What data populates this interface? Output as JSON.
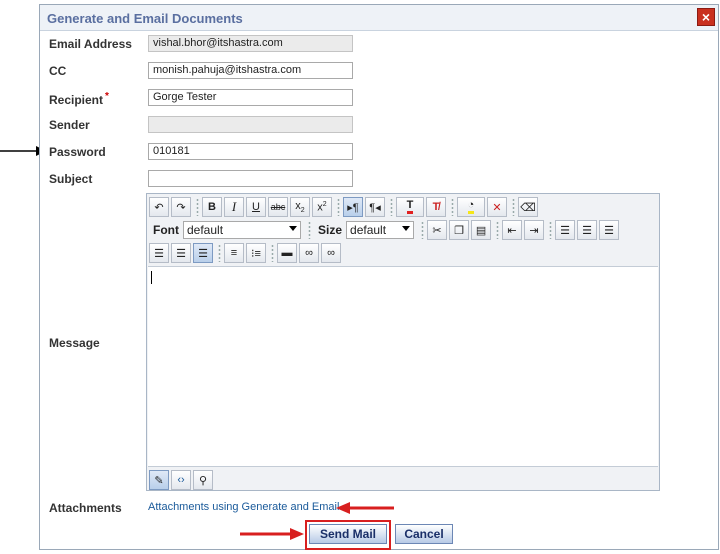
{
  "dialog": {
    "title": "Generate and Email Documents",
    "close_symbol": "×"
  },
  "form": {
    "email_address_label": "Email Address",
    "email_address_value": "vishal.bhor@itshastra.com",
    "cc_label": "CC",
    "cc_value": "monish.pahuja@itshastra.com",
    "recipient_label": "Recipient",
    "recipient_required": "*",
    "recipient_value": "Gorge Tester",
    "sender_label": "Sender",
    "sender_value": "",
    "password_label": "Password",
    "password_value": "010181",
    "subject_label": "Subject",
    "subject_value": "",
    "message_label": "Message",
    "attachments_label": "Attachments",
    "attachments_link": "Attachments using Generate and Email"
  },
  "toolbar": {
    "font_label": "Font",
    "font_value": "default",
    "size_label": "Size",
    "size_value": "default"
  },
  "buttons": {
    "send_label": "Send Mail",
    "cancel_label": "Cancel"
  },
  "colors": {
    "annotation_red": "#d81f1f",
    "title_blue": "#5a6fa0",
    "link_blue": "#1a5a9a"
  }
}
